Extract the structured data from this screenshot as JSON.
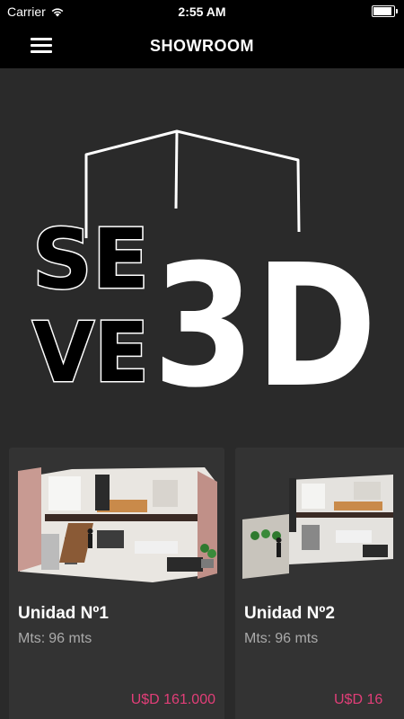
{
  "status_bar": {
    "carrier": "Carrier",
    "time": "2:55 AM",
    "battery_level": 0.9,
    "wifi_icon": "wifi-icon",
    "battery_icon": "battery-icon"
  },
  "nav": {
    "title": "SHOWROOM",
    "menu_icon": "hamburger-menu-icon"
  },
  "logo": {
    "text_top": "SE",
    "text_bottom": "VE",
    "text_3d": "3D"
  },
  "units": [
    {
      "title": "Unidad Nº1",
      "size_label": "Mts:",
      "size_value": "96 mts",
      "price": "U$D 161.000"
    },
    {
      "title": "Unidad Nº2",
      "size_label": "Mts:",
      "size_value": "96 mts",
      "price": "U$D 16"
    }
  ],
  "colors": {
    "background": "#2a2a2a",
    "bar": "#000000",
    "card": "#333333",
    "price": "#e23e78"
  }
}
